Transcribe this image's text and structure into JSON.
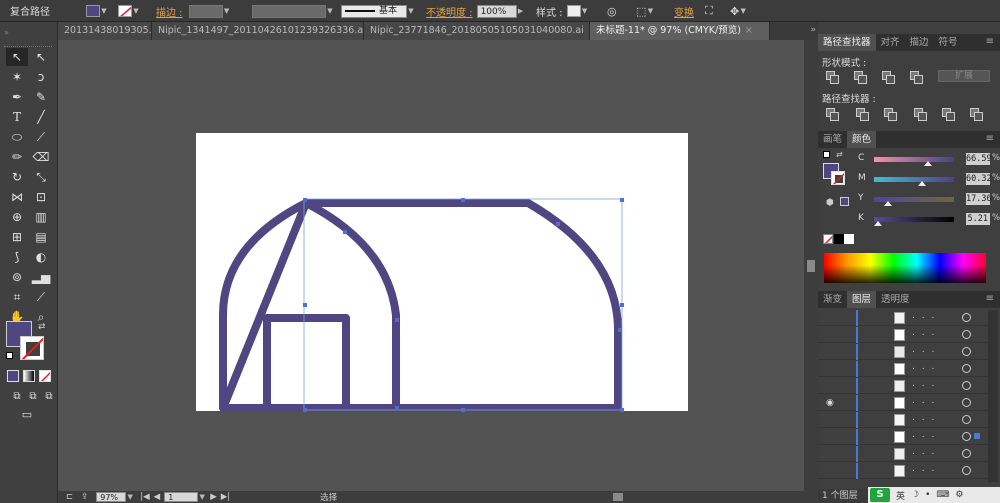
{
  "control_bar": {
    "object_type": "复合路径",
    "stroke_label": "描边 :",
    "stroke_style_label": "基本",
    "opacity_label": "不透明度 :",
    "opacity_value": "100%",
    "style_label": "样式 :",
    "transform_label": "变换",
    "fill_color": "#4f4682"
  },
  "tabs": [
    {
      "label": "20131438019305.ai",
      "active": false
    },
    {
      "label": "Nipic_1341497_20110426101239326336.ai",
      "active": false
    },
    {
      "label": "Nipic_23771846_20180505105031040080.ai",
      "active": false
    },
    {
      "label": "未标题-11* @ 97% (CMYK/预览)",
      "active": true
    }
  ],
  "tabs_more": "»",
  "close_glyph": "×",
  "status": {
    "zoom": "97%",
    "page": "1",
    "tool_name": "选择"
  },
  "pathfinder": {
    "tabs": [
      "路径查找器",
      "对齐",
      "描边",
      "符号"
    ],
    "shape_modes_label": "形状模式 :",
    "pathfinders_label": "路径查找器 :",
    "expand_label": "扩展"
  },
  "color_panel": {
    "tabs": [
      "画笔",
      "颜色"
    ],
    "channels": [
      {
        "name": "C",
        "value": "66.59",
        "fraction": 0.67,
        "gradient": "linear-gradient(to right,#ff8da8,#3f4390)"
      },
      {
        "name": "M",
        "value": "60.32",
        "fraction": 0.6,
        "gradient": "linear-gradient(to right,#3dbfd6,#503f89)"
      },
      {
        "name": "Y",
        "value": "17.36",
        "fraction": 0.17,
        "gradient": "linear-gradient(to right,#4f45a0,#6e6640)"
      },
      {
        "name": "K",
        "value": "5.21",
        "fraction": 0.05,
        "gradient": "linear-gradient(to right,#5a4a9a,#000000)"
      }
    ],
    "percent": "%",
    "fill_color": "#4f4682"
  },
  "layers_panel": {
    "tabs": [
      "渐变",
      "图层",
      "透明度"
    ],
    "row_count": 10,
    "footer": "1 个图层"
  },
  "ime": {
    "logo": "S",
    "mode": "英"
  },
  "tools": [
    "selection-tool",
    "direct-selection-tool",
    "magic-wand-tool",
    "lasso-tool",
    "pen-tool",
    "curvature-tool",
    "type-tool",
    "line-tool",
    "ellipse-tool",
    "paintbrush-tool",
    "pencil-tool",
    "eraser-tool",
    "rotate-tool",
    "scale-tool",
    "width-tool",
    "free-transform-tool",
    "shape-builder-tool",
    "perspective-tool",
    "mesh-tool",
    "gradient-tool",
    "eyedropper-tool",
    "blend-tool",
    "symbol-sprayer-tool",
    "column-graph-tool",
    "artboard-tool",
    "slice-tool",
    "hand-tool",
    "zoom-tool"
  ]
}
